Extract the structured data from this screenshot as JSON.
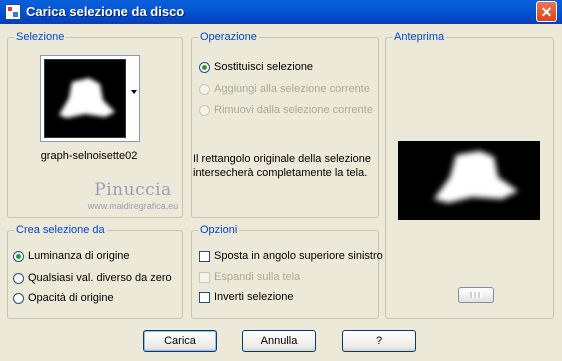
{
  "window": {
    "title": "Carica selezione da disco",
    "close_label": "✕"
  },
  "selezione": {
    "legend": "Selezione",
    "file_name": "graph-selnoisette02"
  },
  "operazione": {
    "legend": "Operazione",
    "options": [
      {
        "label": "Sostituisci selezione",
        "selected": true,
        "enabled": true
      },
      {
        "label": "Aggiungi alla selezione corrente",
        "selected": false,
        "enabled": false
      },
      {
        "label": "Rimuovi dalla selezione corrente",
        "selected": false,
        "enabled": false
      }
    ],
    "description": "Il rettangolo originale della selezione intersecherà completamente la tela."
  },
  "anteprima": {
    "legend": "Anteprima"
  },
  "crea": {
    "legend": "Crea selezione da",
    "options": [
      {
        "label": "Luminanza di origine",
        "selected": true
      },
      {
        "label": "Qualsiasi val. diverso da zero",
        "selected": false
      },
      {
        "label": "Opacità di origine",
        "selected": false
      }
    ]
  },
  "opzioni": {
    "legend": "Opzioni",
    "items": [
      {
        "label": "Sposta in angolo superiore sinistro",
        "checked": false,
        "enabled": true
      },
      {
        "label": "Espandi sulla tela",
        "checked": false,
        "enabled": false
      },
      {
        "label": "Inverti selezione",
        "checked": false,
        "enabled": true
      }
    ]
  },
  "watermark": {
    "name": "Pinuccia",
    "url": "www.maidiregrafica.eu"
  },
  "buttons": {
    "ok": "Carica",
    "cancel": "Annulla",
    "help": "?"
  },
  "colors": {
    "title_bar": "#0458d6",
    "legend_text": "#0046d5",
    "dialog_bg": "#ece9d8",
    "radio_selected": "#2e9a2e"
  }
}
